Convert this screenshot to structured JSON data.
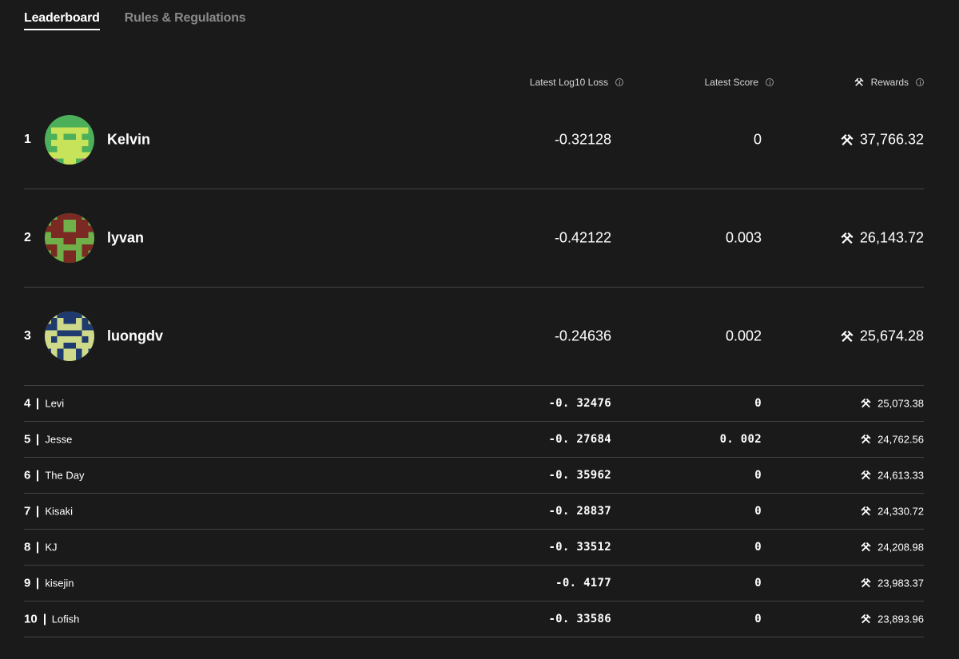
{
  "tabs": [
    {
      "label": "Leaderboard",
      "active": true
    },
    {
      "label": "Rules & Regulations",
      "active": false
    }
  ],
  "columns": {
    "loss": "Latest Log10 Loss",
    "score": "Latest Score",
    "rewards": "Rewards"
  },
  "icons": {
    "reward": "pick-hammer-icon",
    "info": "info-icon"
  },
  "top_entries": [
    {
      "rank": "1",
      "name": "Kelvin",
      "loss": "-0.32128",
      "score": "0",
      "reward": "37,766.32",
      "avatar_colors": [
        "#4caf5a",
        "#c7e35a",
        "#b8508c"
      ]
    },
    {
      "rank": "2",
      "name": "lyvan",
      "loss": "-0.42122",
      "score": "0.003",
      "reward": "26,143.72",
      "avatar_colors": [
        "#6fb04a",
        "#7a2a22"
      ]
    },
    {
      "rank": "3",
      "name": "luongdv",
      "loss": "-0.24636",
      "score": "0.002",
      "reward": "25,674.28",
      "avatar_colors": [
        "#cfd98a",
        "#1f3a6e"
      ]
    }
  ],
  "entries": [
    {
      "rank": "4",
      "name": "Levi",
      "loss": "-0. 32476",
      "score": "0",
      "reward": "25,073.38"
    },
    {
      "rank": "5",
      "name": "Jesse",
      "loss": "-0. 27684",
      "score": "0. 002",
      "reward": "24,762.56"
    },
    {
      "rank": "6",
      "name": "The Day",
      "loss": "-0. 35962",
      "score": "0",
      "reward": "24,613.33"
    },
    {
      "rank": "7",
      "name": "Kisaki",
      "loss": "-0. 28837",
      "score": "0",
      "reward": "24,330.72"
    },
    {
      "rank": "8",
      "name": "KJ",
      "loss": "-0. 33512",
      "score": "0",
      "reward": "24,208.98"
    },
    {
      "rank": "9",
      "name": "kisejin",
      "loss": "-0. 4177",
      "score": "0",
      "reward": "23,983.37"
    },
    {
      "rank": "10",
      "name": "Lofish",
      "loss": "-0. 33586",
      "score": "0",
      "reward": "23,893.96"
    }
  ]
}
